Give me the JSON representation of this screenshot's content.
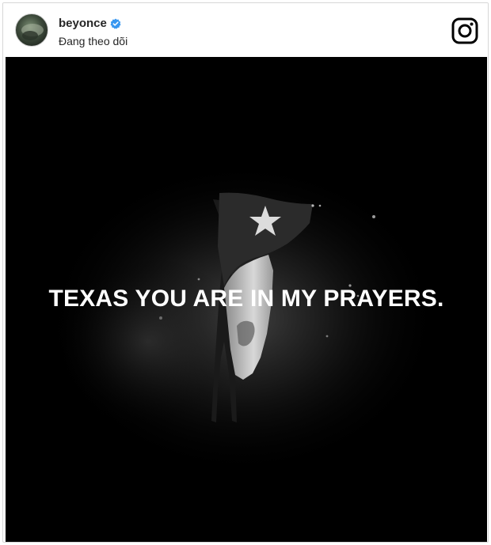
{
  "post": {
    "username": "beyonce",
    "follow_status": "Đang theo dõi",
    "verified": true,
    "image_caption": "TEXAS YOU ARE IN MY PRAYERS."
  },
  "icons": {
    "verified": "verified-badge-icon",
    "brand": "instagram-icon",
    "flag_star": "star-icon"
  },
  "colors": {
    "verified_blue": "#3897f0",
    "photo_background": "#000000",
    "text_primary": "#262626"
  }
}
